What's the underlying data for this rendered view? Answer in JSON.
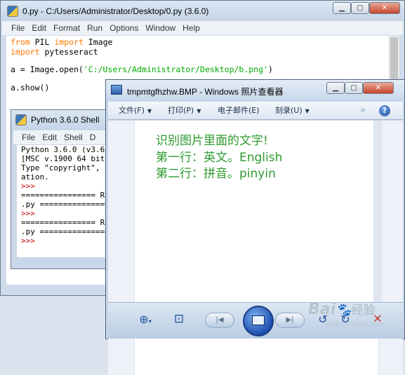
{
  "editor": {
    "title": "0.py - C:/Users/Administrator/Desktop/0.py (3.6.0)",
    "menu": [
      "File",
      "Edit",
      "Format",
      "Run",
      "Options",
      "Window",
      "Help"
    ],
    "code": {
      "line1": {
        "k1": "from",
        "t1": " PIL ",
        "k2": "import",
        "t2": " Image"
      },
      "line2": {
        "k1": "import",
        "t1": " pytesseract"
      },
      "line3": {
        "t1": "a = Image.open(",
        "s": "'C:/Users/Administrator/Desktop/b.png'",
        "t2": ")"
      },
      "line4": "a.show()"
    }
  },
  "shell": {
    "title": "Python 3.6.0 Shell",
    "menu": [
      "File",
      "Edit",
      "Shell",
      "D"
    ],
    "lines": [
      "Python 3.6.0 (v3.6",
      "[MSC v.1900 64 bit",
      "Type \"copyright\", \"",
      "ation.",
      ">>> ",
      "================ R",
      ".py ===============",
      ">>> ",
      "================ R",
      ".py ===============",
      ">>> "
    ]
  },
  "viewer": {
    "title": "tmpmtgfhzhw.BMP - Windows 照片查看器",
    "toolbar": [
      "文件(F)",
      "打印(P)",
      "电子邮件(E)",
      "刻录(U)"
    ],
    "image_text": [
      "识别图片里面的文字!",
      "第一行：英文。English",
      "第二行：拼音。pinyin"
    ]
  },
  "watermark": {
    "brand": "Bai",
    "brand_cn": "经验",
    "url": "jingyan.baidu.com"
  },
  "colors": {
    "keyword": "#ff7700",
    "string": "#00aa00",
    "prompt": "#c00000",
    "image_text": "#2e9a2e"
  }
}
